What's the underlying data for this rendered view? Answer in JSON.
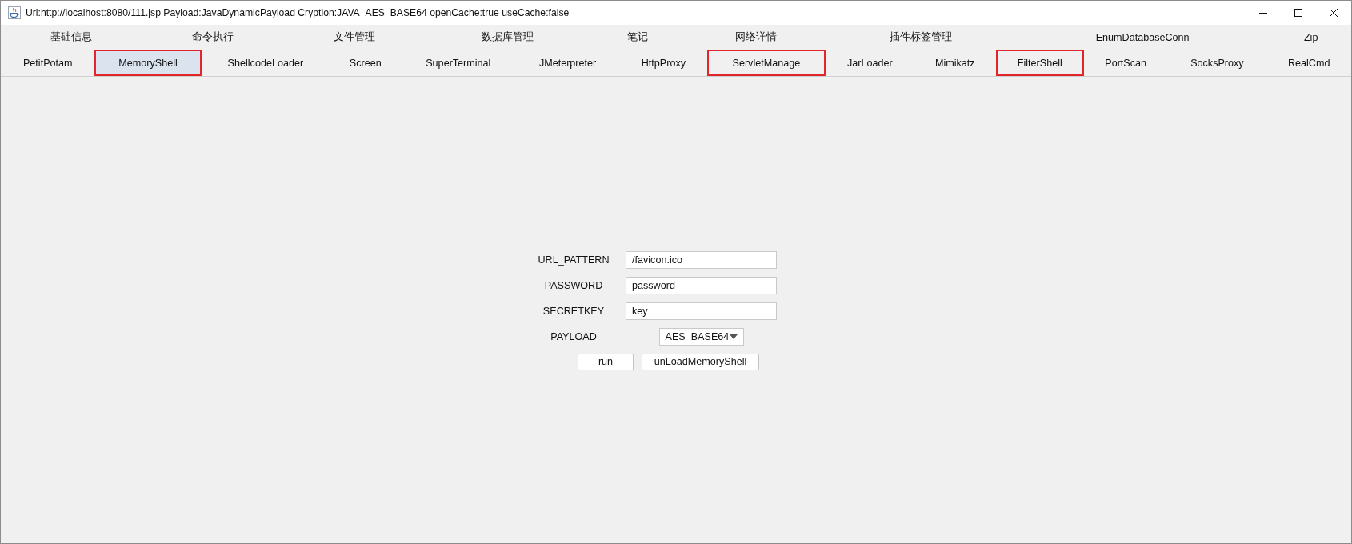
{
  "window": {
    "title": "Url:http://localhost:8080/111.jsp Payload:JavaDynamicPayload Cryption:JAVA_AES_BASE64 openCache:true useCache:false"
  },
  "tab_rows": [
    {
      "tabs": [
        {
          "label": "基础信息",
          "selected": false,
          "highlighted": false
        },
        {
          "label": "命令执行",
          "selected": false,
          "highlighted": false
        },
        {
          "label": "文件管理",
          "selected": false,
          "highlighted": false
        },
        {
          "label": "数据库管理",
          "selected": false,
          "highlighted": false
        },
        {
          "label": "笔记",
          "selected": false,
          "highlighted": false
        },
        {
          "label": "网络详情",
          "selected": false,
          "highlighted": false
        },
        {
          "label": "插件标签管理",
          "selected": false,
          "highlighted": false
        },
        {
          "label": "EnumDatabaseConn",
          "selected": false,
          "highlighted": false
        },
        {
          "label": "Zip",
          "selected": false,
          "highlighted": false
        }
      ]
    },
    {
      "tabs": [
        {
          "label": "PetitPotam",
          "selected": false,
          "highlighted": false
        },
        {
          "label": "MemoryShell",
          "selected": true,
          "highlighted": true
        },
        {
          "label": "ShellcodeLoader",
          "selected": false,
          "highlighted": false
        },
        {
          "label": "Screen",
          "selected": false,
          "highlighted": false
        },
        {
          "label": "SuperTerminal",
          "selected": false,
          "highlighted": false
        },
        {
          "label": "JMeterpreter",
          "selected": false,
          "highlighted": false
        },
        {
          "label": "HttpProxy",
          "selected": false,
          "highlighted": false
        },
        {
          "label": "ServletManage",
          "selected": false,
          "highlighted": true
        },
        {
          "label": "JarLoader",
          "selected": false,
          "highlighted": false
        },
        {
          "label": "Mimikatz",
          "selected": false,
          "highlighted": false
        },
        {
          "label": "FilterShell",
          "selected": false,
          "highlighted": true
        },
        {
          "label": "PortScan",
          "selected": false,
          "highlighted": false
        },
        {
          "label": "SocksProxy",
          "selected": false,
          "highlighted": false
        },
        {
          "label": "RealCmd",
          "selected": false,
          "highlighted": false
        }
      ]
    }
  ],
  "form": {
    "fields": [
      {
        "kind": "text",
        "label": "URL_PATTERN",
        "value": "/favicon.ico"
      },
      {
        "kind": "text",
        "label": "PASSWORD",
        "value": "password"
      },
      {
        "kind": "text",
        "label": "SECRETKEY",
        "value": "key"
      },
      {
        "kind": "select",
        "label": "PAYLOAD",
        "value": "AES_BASE64"
      }
    ],
    "buttons": [
      "run",
      "unLoadMemoryShell"
    ]
  }
}
